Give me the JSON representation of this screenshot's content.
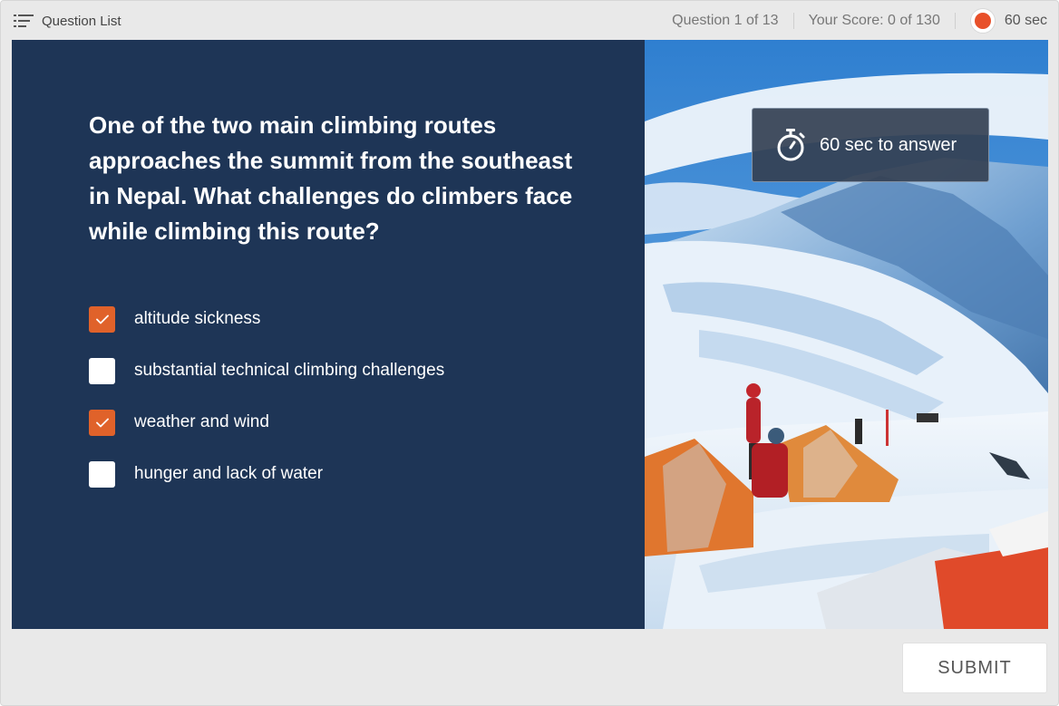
{
  "header": {
    "question_list_label": "Question List",
    "question_counter": "Question 1 of 13",
    "score": "Your Score: 0 of 130",
    "timer": "60 sec"
  },
  "question": {
    "text": "One of the two main climbing routes approaches the summit from the southeast in Nepal. What challenges do climbers face while climbing this route?",
    "options": [
      {
        "label": "altitude sickness",
        "checked": true
      },
      {
        "label": "substantial technical climbing challenges",
        "checked": false
      },
      {
        "label": "weather and wind",
        "checked": true
      },
      {
        "label": "hunger and lack of water",
        "checked": false
      }
    ]
  },
  "image_badge": {
    "text": "60 sec to answer",
    "icon": "stopwatch-icon"
  },
  "footer": {
    "submit_label": "SUBMIT"
  },
  "colors": {
    "panel": "#1e3556",
    "accent": "#e0622a",
    "timer_dot": "#e8502a",
    "frame": "#e9e9e9"
  }
}
